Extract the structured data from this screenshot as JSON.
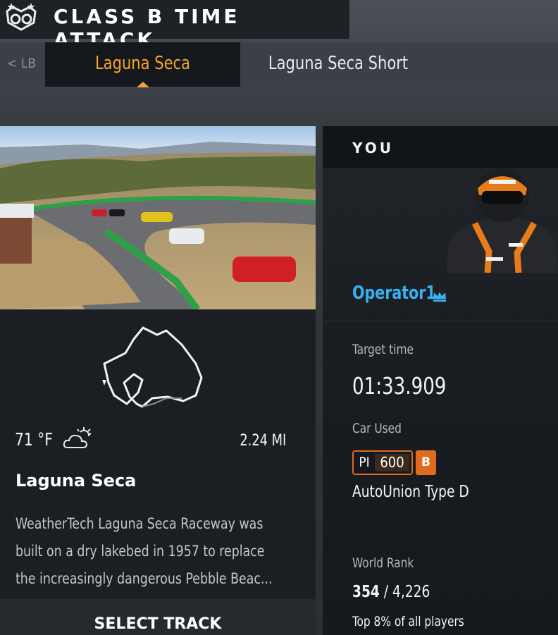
{
  "header": {
    "title": "CLASS B TIME ATTACK",
    "logo_icon": "rivals-emblem-icon"
  },
  "tabs": {
    "back_label": "< LB",
    "items": [
      {
        "label": "Laguna Seca",
        "active": true
      },
      {
        "label": "Laguna Seca Short",
        "active": false
      }
    ],
    "active_color": "#f5a42c"
  },
  "track": {
    "temperature": "71 °F",
    "weather_icon": "partly-cloudy-icon",
    "length": "2.24 MI",
    "name": "Laguna Seca",
    "description_lines": [
      "WeatherTech Laguna Seca Raceway was",
      "built on a dry lakebed in 1957 to replace",
      "the increasingly dangerous Pebble Beac..."
    ],
    "select_label": "SELECT TRACK"
  },
  "player": {
    "section_label": "YOU",
    "name": "Operator1",
    "name_color": "#3ab0ef",
    "badge_icon": "crown-icon",
    "target_time_label": "Target time",
    "target_time": "01:33.909",
    "car_label": "Car Used",
    "pi_label": "PI",
    "pi_value": "600",
    "car_class": "B",
    "class_color": "#e06a1e",
    "car_name": "AutoUnion Type D",
    "rank_label": "World Rank",
    "rank": "354",
    "rank_total": "4,226",
    "rank_percentile": "Top 8% of all players"
  }
}
